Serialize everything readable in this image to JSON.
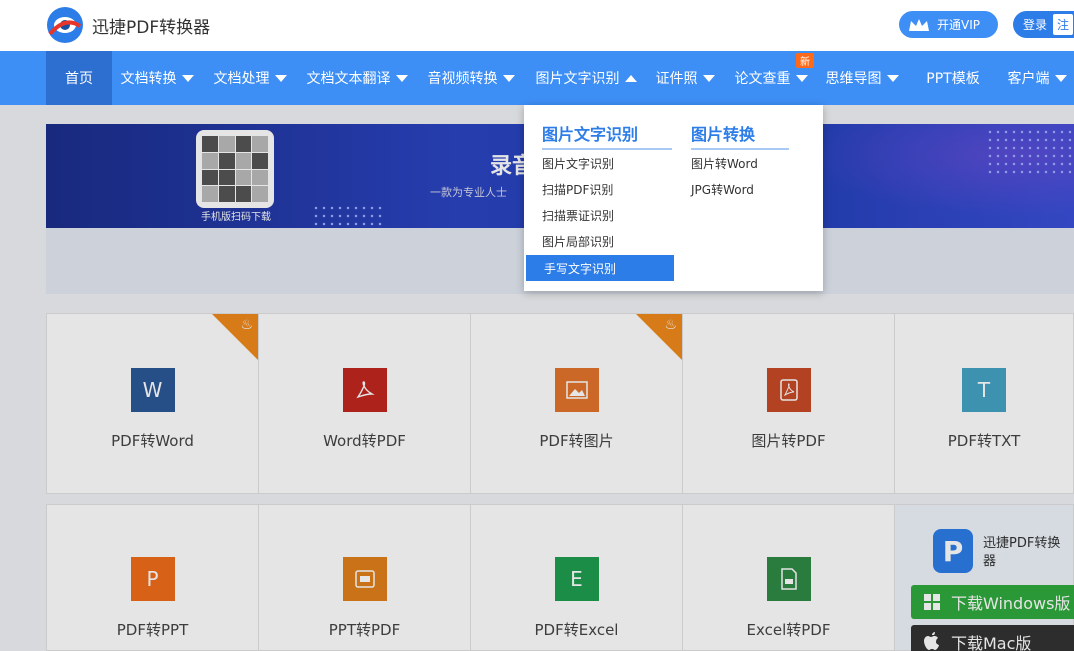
{
  "header": {
    "brand": "迅捷PDF转换器",
    "vip_label": "开通VIP",
    "login_label": "登录",
    "register_label": "注"
  },
  "nav": {
    "items": [
      {
        "label": "首页"
      },
      {
        "label": "文档转换"
      },
      {
        "label": "文档处理"
      },
      {
        "label": "文档文本翻译"
      },
      {
        "label": "音视频转换"
      },
      {
        "label": "图片文字识别"
      },
      {
        "label": "证件照"
      },
      {
        "label": "论文查重"
      },
      {
        "label": "思维导图"
      },
      {
        "label": "PPT模板"
      },
      {
        "label": "客户端"
      }
    ],
    "new_badge": "新"
  },
  "banner": {
    "title": "录音",
    "subtitle": "一款为专业人士",
    "qr_label": "手机版扫码下载"
  },
  "dropdown": {
    "col1_title": "图片文字识别",
    "col1_items": [
      "图片文字识别",
      "扫描PDF识别",
      "扫描票证识别",
      "图片局部识别",
      "手写文字识别"
    ],
    "col2_title": "图片转换",
    "col2_items": [
      "图片转Word",
      "JPG转Word"
    ]
  },
  "tiles": [
    {
      "label": "PDF转Word",
      "icon_text": "W",
      "color": "#2b5797",
      "hot": true
    },
    {
      "label": "Word转PDF",
      "icon_text": "",
      "color": "#c1271f",
      "hot": false
    },
    {
      "label": "PDF转图片",
      "icon_text": "",
      "color": "#e2742c",
      "hot": true
    },
    {
      "label": "图片转PDF",
      "icon_text": "",
      "color": "#c84a27",
      "hot": false
    },
    {
      "label": "PDF转TXT",
      "icon_text": "T",
      "color": "#45a3c4",
      "hot": false
    },
    {
      "label": "PDF转PPT",
      "icon_text": "P",
      "color": "#ef6c1a",
      "hot": false
    },
    {
      "label": "PPT转PDF",
      "icon_text": "",
      "color": "#e07f1a",
      "hot": false
    },
    {
      "label": "PDF转Excel",
      "icon_text": "E",
      "color": "#1f9d4f",
      "hot": false
    },
    {
      "label": "Excel转PDF",
      "icon_text": "",
      "color": "#2e8b46",
      "hot": false
    }
  ],
  "promo": {
    "name": "迅捷PDF转换器",
    "win_label": "下载Windows版",
    "mac_label": "下载Mac版"
  }
}
